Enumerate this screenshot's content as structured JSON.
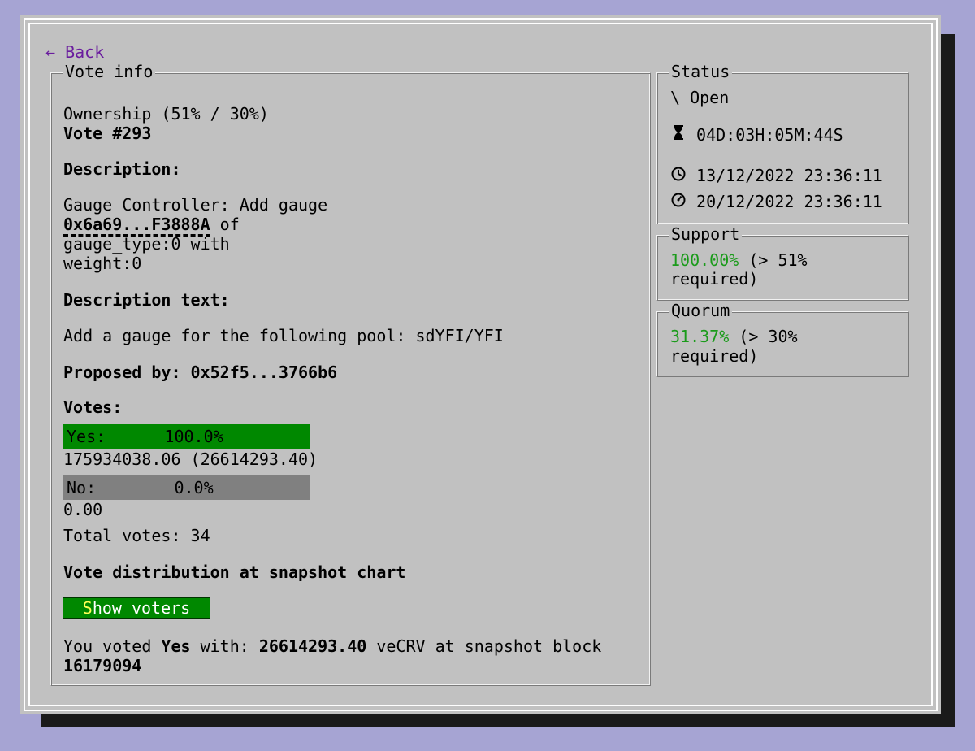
{
  "nav": {
    "back_arrow": "←",
    "back_label": "Back"
  },
  "vote_info": {
    "legend": "Vote info",
    "ownership": "Ownership (51% / 30%)",
    "vote_number": "Vote #293",
    "description_heading": "Description:",
    "description_line1": "Gauge Controller: Add gauge",
    "gauge_address": "0x6a69...F3888A",
    "description_of": " of",
    "description_line3": "gauge_type:0 with",
    "description_line4": "weight:0",
    "description_text_heading": "Description text:",
    "description_text": "Add a gauge for the following pool: sdYFI/YFI",
    "proposed_by_label": "Proposed by: ",
    "proposer_address": "0x52f5...3766b6",
    "votes_heading": "Votes:",
    "yes_label": "Yes:",
    "yes_percent": "100.0%",
    "yes_fraction": 1.0,
    "yes_amount": "175934038.06 (26614293.40)",
    "no_label": "No:",
    "no_percent": "0.0%",
    "no_fraction": 0.0,
    "no_amount": "0.00",
    "total_votes": "Total votes: 34",
    "distribution_chart_label": "Vote distribution at snapshot chart",
    "show_voters_first": "S",
    "show_voters_rest": "how voters",
    "you_voted_prefix": "You voted ",
    "you_voted_choice": "Yes",
    "you_voted_with": " with: ",
    "you_voted_amount": "26614293.40",
    "you_voted_suffix": " veCRV at snapshot block",
    "snapshot_block": "16179094"
  },
  "status": {
    "legend": "Status",
    "spinner": "\\",
    "state": "Open",
    "countdown": "04D:03H:05M:44S",
    "start_time": "13/12/2022 23:36:11",
    "end_time": "20/12/2022 23:36:11"
  },
  "support": {
    "legend": "Support",
    "value": "100.00%",
    "requirement": " (> 51%",
    "requirement_line2": "required)"
  },
  "quorum": {
    "legend": "Quorum",
    "value": "31.37%",
    "requirement": " (> 30%",
    "requirement_line2": "required)"
  },
  "colors": {
    "background": "#a6a4d3",
    "panel": "#c1c1c1",
    "accent_green": "#008800",
    "percent_green": "#1b9b1b",
    "link_purple": "#6a1c9e",
    "bar_grey": "#808080"
  },
  "icons": {
    "back": "arrow-left-icon",
    "countdown": "hourglass-icon",
    "start": "clock-icon",
    "end": "gauge-icon"
  }
}
